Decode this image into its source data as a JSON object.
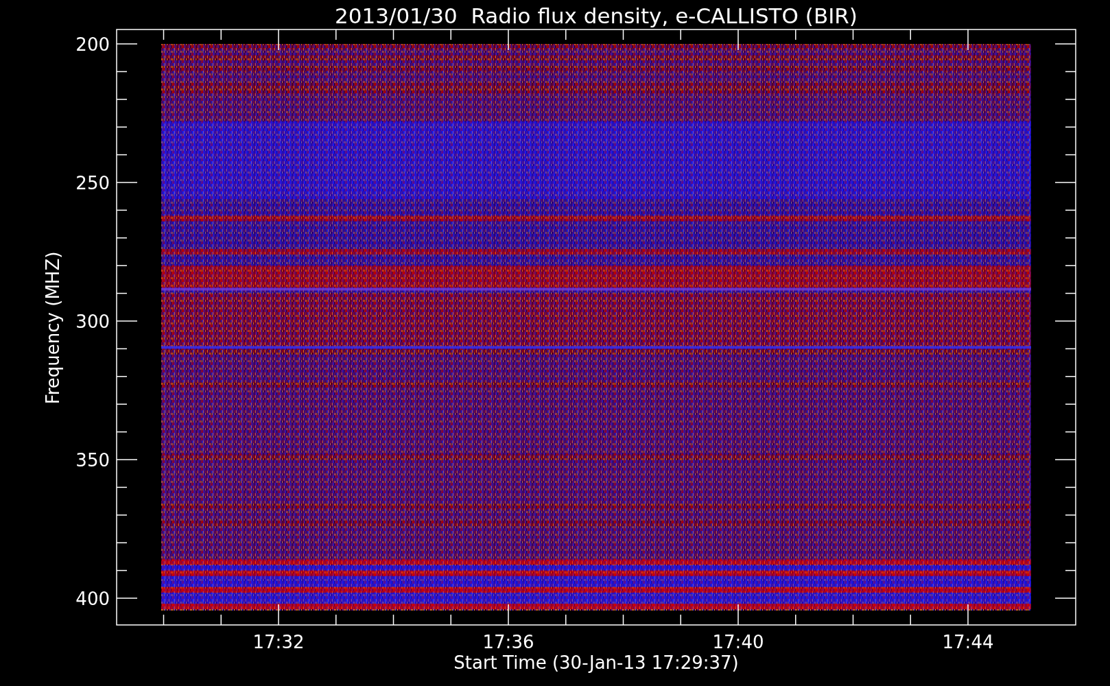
{
  "title": "2013/01/30  Radio flux density, e-CALLISTO (BIR)",
  "y_axis": {
    "label": "Frequency (MHZ)",
    "ticks": [
      "200",
      "250",
      "300",
      "350",
      "400"
    ]
  },
  "x_axis": {
    "label": "Start Time (30-Jan-13 17:29:37)",
    "ticks": [
      "17:32",
      "17:36",
      "17:40",
      "17:44"
    ]
  }
}
